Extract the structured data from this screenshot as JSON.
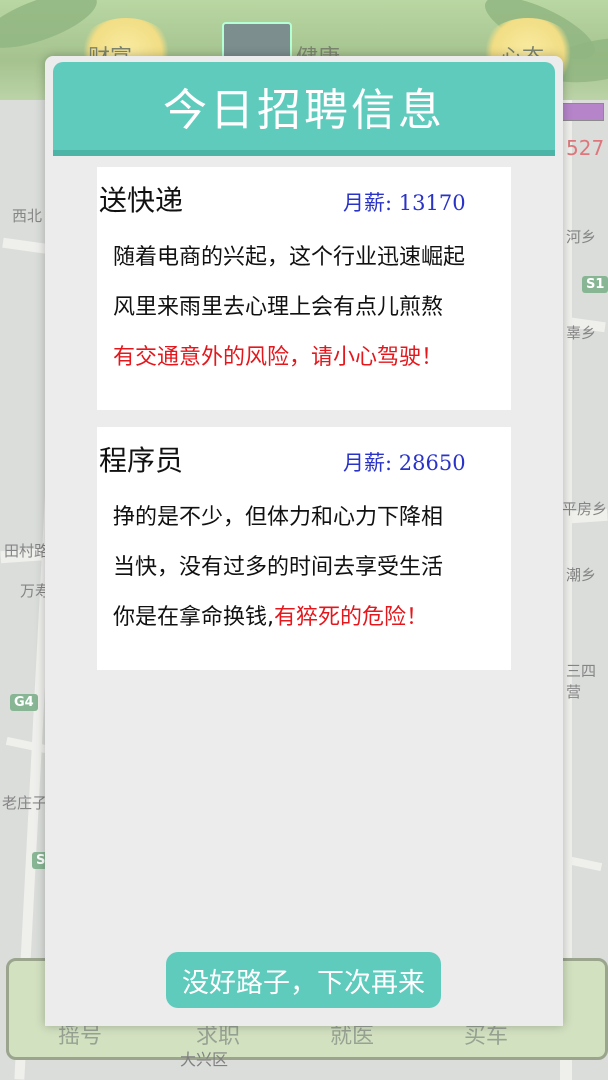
{
  "background": {
    "stats": [
      "财富",
      "健康",
      "心态"
    ],
    "score": "527",
    "map_labels": [
      "西北",
      "河乡",
      "S1",
      "辜乡",
      "平房乡",
      "田村路",
      "万寿",
      "潮乡",
      "三四营",
      "G4",
      "老庄子",
      "S"
    ],
    "bottom_tabs": [
      "摇号",
      "求职",
      "就医",
      "买车"
    ],
    "bottom_district": "大兴区"
  },
  "popup": {
    "title": "今日招聘信息",
    "jobs": [
      {
        "title": "送快递",
        "salary_label": "月薪:",
        "salary": "13170",
        "line1": "随着电商的兴起，这个行业迅速崛起",
        "line2": "风里来雨里去心理上会有点儿煎熬",
        "warning": "有交通意外的风险，请小心驾驶！"
      },
      {
        "title": "程序员",
        "salary_label": "月薪:",
        "salary": "28650",
        "line1": "挣的是不少，但体力和心力下降相",
        "line2": "当快，没有过多的时间去享受生活",
        "line3_prefix": "你是在拿命换钱,",
        "warning": "有猝死的危险！"
      }
    ],
    "dismiss_label": "没好路子，下次再来"
  },
  "colors": {
    "header": "#5fcbbd",
    "salary": "#2a33c8",
    "warning": "#e4171c"
  }
}
